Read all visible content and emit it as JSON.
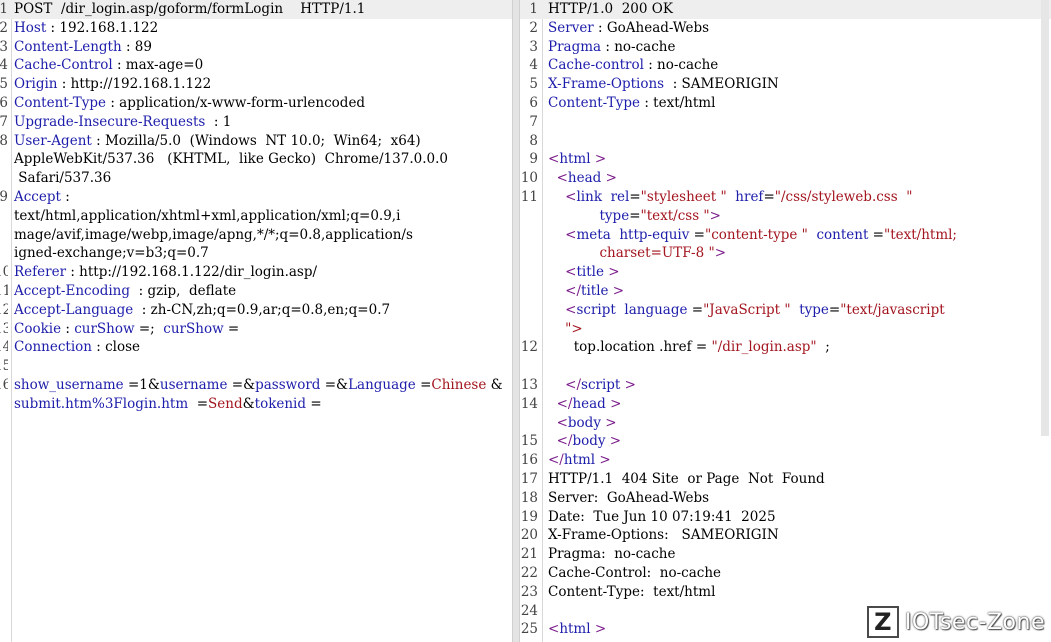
{
  "request": {
    "lines": [
      {
        "num": "1",
        "parts": [
          {
            "t": "POST  /dir_login.asp/goform/formLogin    HTTP/1.1",
            "c": "d"
          }
        ],
        "hl": true
      },
      {
        "num": "2",
        "parts": [
          {
            "t": "Host",
            "c": "k"
          },
          {
            "t": " : 192.168.1.122",
            "c": "d"
          }
        ]
      },
      {
        "num": "3",
        "parts": [
          {
            "t": "Content-Length",
            "c": "k"
          },
          {
            "t": " : 89",
            "c": "d"
          }
        ]
      },
      {
        "num": "4",
        "parts": [
          {
            "t": "Cache-Control",
            "c": "k"
          },
          {
            "t": " : max-age=0",
            "c": "d"
          }
        ]
      },
      {
        "num": "5",
        "parts": [
          {
            "t": "Origin",
            "c": "k"
          },
          {
            "t": " : http://192.168.1.122",
            "c": "d"
          }
        ]
      },
      {
        "num": "6",
        "parts": [
          {
            "t": "Content-Type",
            "c": "k"
          },
          {
            "t": " : application/x-www-form-urlencoded",
            "c": "d"
          }
        ]
      },
      {
        "num": "7",
        "parts": [
          {
            "t": "Upgrade-Insecure-Requests",
            "c": "k"
          },
          {
            "t": "  : 1",
            "c": "d"
          }
        ]
      },
      {
        "num": "8",
        "parts": [
          {
            "t": "User-Agent",
            "c": "k"
          },
          {
            "t": " : Mozilla/5.0  (Windows  NT 10.0;  Win64;  x64)",
            "c": "d"
          }
        ]
      },
      {
        "num": "",
        "parts": [
          {
            "t": "AppleWebKit/537.36   (KHTML,  like Gecko)  Chrome/137.0.0.0",
            "c": "d"
          }
        ]
      },
      {
        "num": "",
        "parts": [
          {
            "t": " Safari/537.36",
            "c": "d"
          }
        ]
      },
      {
        "num": "9",
        "parts": [
          {
            "t": "Accept",
            "c": "k"
          },
          {
            "t": " :",
            "c": "d"
          }
        ]
      },
      {
        "num": "",
        "parts": [
          {
            "t": "text/html,application/xhtml+xml,application/xml;q=0.9,i",
            "c": "d"
          }
        ]
      },
      {
        "num": "",
        "parts": [
          {
            "t": "mage/avif,image/webp,image/apng,*/*;q=0.8,application/s",
            "c": "d"
          }
        ]
      },
      {
        "num": "",
        "parts": [
          {
            "t": "igned-exchange;v=b3;q=0.7",
            "c": "d"
          }
        ]
      },
      {
        "num": "10",
        "parts": [
          {
            "t": "Referer",
            "c": "k"
          },
          {
            "t": " : http://192.168.1.122/dir_login.asp/",
            "c": "d"
          }
        ]
      },
      {
        "num": "11",
        "parts": [
          {
            "t": "Accept-Encoding",
            "c": "k"
          },
          {
            "t": "  : gzip,  deflate",
            "c": "d"
          }
        ]
      },
      {
        "num": "12",
        "parts": [
          {
            "t": "Accept-Language",
            "c": "k"
          },
          {
            "t": "  : zh-CN,zh;q=0.9,ar;q=0.8,en;q=0.7",
            "c": "d"
          }
        ]
      },
      {
        "num": "13",
        "parts": [
          {
            "t": "Cookie",
            "c": "k"
          },
          {
            "t": " : ",
            "c": "d"
          },
          {
            "t": "curShow",
            "c": "k"
          },
          {
            "t": " =;  ",
            "c": "d"
          },
          {
            "t": "curShow",
            "c": "k"
          },
          {
            "t": " =",
            "c": "d"
          }
        ]
      },
      {
        "num": "14",
        "parts": [
          {
            "t": "Connection",
            "c": "k"
          },
          {
            "t": " : close",
            "c": "d"
          }
        ]
      },
      {
        "num": "15",
        "parts": []
      },
      {
        "num": "16",
        "parts": [
          {
            "t": "show_username",
            "c": "k"
          },
          {
            "t": " =1&",
            "c": "d"
          },
          {
            "t": "username",
            "c": "k"
          },
          {
            "t": " =&",
            "c": "d"
          },
          {
            "t": "password",
            "c": "k"
          },
          {
            "t": " =&",
            "c": "d"
          },
          {
            "t": "Language",
            "c": "k"
          },
          {
            "t": " =",
            "c": "d"
          },
          {
            "t": "Chinese",
            "c": "s"
          },
          {
            "t": " &",
            "c": "d"
          }
        ]
      },
      {
        "num": "",
        "parts": [
          {
            "t": "submit.htm%3Flogin.htm",
            "c": "k"
          },
          {
            "t": "  =",
            "c": "d"
          },
          {
            "t": "Send",
            "c": "s"
          },
          {
            "t": "&",
            "c": "d"
          },
          {
            "t": "tokenid",
            "c": "k"
          },
          {
            "t": " =",
            "c": "d"
          }
        ]
      }
    ]
  },
  "response": {
    "lines": [
      {
        "num": "1",
        "parts": [
          {
            "t": "HTTP/1.0  200 OK",
            "c": "d"
          }
        ],
        "hl": true
      },
      {
        "num": "2",
        "parts": [
          {
            "t": "Server",
            "c": "k"
          },
          {
            "t": " : GoAhead-Webs",
            "c": "d"
          }
        ]
      },
      {
        "num": "3",
        "parts": [
          {
            "t": "Pragma",
            "c": "k"
          },
          {
            "t": " : no-cache",
            "c": "d"
          }
        ]
      },
      {
        "num": "4",
        "parts": [
          {
            "t": "Cache-control",
            "c": "k"
          },
          {
            "t": " : no-cache",
            "c": "d"
          }
        ]
      },
      {
        "num": "5",
        "parts": [
          {
            "t": "X-Frame-Options",
            "c": "k"
          },
          {
            "t": "  : SAMEORIGIN",
            "c": "d"
          }
        ]
      },
      {
        "num": "6",
        "parts": [
          {
            "t": "Content-Type",
            "c": "k"
          },
          {
            "t": " : text/html",
            "c": "d"
          }
        ]
      },
      {
        "num": "7",
        "parts": []
      },
      {
        "num": "8",
        "parts": []
      },
      {
        "num": "9",
        "parts": [
          {
            "t": "<",
            "c": "t"
          },
          {
            "t": "html",
            "c": "p"
          },
          {
            "t": " >",
            "c": "t"
          }
        ]
      },
      {
        "num": "10",
        "parts": [
          {
            "t": "  <",
            "c": "t"
          },
          {
            "t": "head",
            "c": "p"
          },
          {
            "t": " >",
            "c": "t"
          }
        ]
      },
      {
        "num": "11",
        "parts": [
          {
            "t": "    <",
            "c": "t"
          },
          {
            "t": "link",
            "c": "p"
          },
          {
            "t": "  ",
            "c": "d"
          },
          {
            "t": "rel",
            "c": "p"
          },
          {
            "t": "=",
            "c": "d"
          },
          {
            "t": "\"stylesheet \"",
            "c": "v"
          },
          {
            "t": "  ",
            "c": "d"
          },
          {
            "t": "href",
            "c": "p"
          },
          {
            "t": "=",
            "c": "d"
          },
          {
            "t": "\"/css/styleweb.css  \"",
            "c": "v"
          }
        ]
      },
      {
        "num": "",
        "parts": [
          {
            "t": "            ",
            "c": "d"
          },
          {
            "t": "type",
            "c": "p"
          },
          {
            "t": "=",
            "c": "d"
          },
          {
            "t": "\"text/css \"",
            "c": "v"
          },
          {
            "t": ">",
            "c": "t"
          }
        ]
      },
      {
        "num": "",
        "parts": [
          {
            "t": "    <",
            "c": "t"
          },
          {
            "t": "meta",
            "c": "p"
          },
          {
            "t": "  ",
            "c": "d"
          },
          {
            "t": "http-equiv",
            "c": "p"
          },
          {
            "t": " =",
            "c": "d"
          },
          {
            "t": "\"content-type \"",
            "c": "v"
          },
          {
            "t": "  ",
            "c": "d"
          },
          {
            "t": "content",
            "c": "p"
          },
          {
            "t": " =",
            "c": "d"
          },
          {
            "t": "\"text/html;",
            "c": "v"
          }
        ]
      },
      {
        "num": "",
        "parts": [
          {
            "t": "            ",
            "c": "d"
          },
          {
            "t": "charset=UTF-8 \"",
            "c": "v"
          },
          {
            "t": ">",
            "c": "t"
          }
        ]
      },
      {
        "num": "",
        "parts": [
          {
            "t": "    <",
            "c": "t"
          },
          {
            "t": "title",
            "c": "p"
          },
          {
            "t": " >",
            "c": "t"
          }
        ]
      },
      {
        "num": "",
        "parts": [
          {
            "t": "    </",
            "c": "t"
          },
          {
            "t": "title",
            "c": "p"
          },
          {
            "t": " >",
            "c": "t"
          }
        ]
      },
      {
        "num": "",
        "parts": [
          {
            "t": "    <",
            "c": "t"
          },
          {
            "t": "script",
            "c": "p"
          },
          {
            "t": "  ",
            "c": "d"
          },
          {
            "t": "language",
            "c": "p"
          },
          {
            "t": " =",
            "c": "d"
          },
          {
            "t": "\"JavaScript \"",
            "c": "v"
          },
          {
            "t": "  ",
            "c": "d"
          },
          {
            "t": "type",
            "c": "p"
          },
          {
            "t": "=",
            "c": "d"
          },
          {
            "t": "\"text/javascript",
            "c": "v"
          }
        ]
      },
      {
        "num": "",
        "parts": [
          {
            "t": "    \">",
            "c": "v"
          }
        ]
      },
      {
        "num": "12",
        "parts": [
          {
            "t": "      top.location",
            "c": "d"
          },
          {
            "t": " .",
            "c": "d"
          },
          {
            "t": "href",
            "c": "d"
          },
          {
            "t": " = ",
            "c": "d"
          },
          {
            "t": "\"/dir_login.asp\"",
            "c": "v"
          },
          {
            "t": "  ;",
            "c": "d"
          }
        ]
      },
      {
        "num": "",
        "parts": []
      },
      {
        "num": "13",
        "parts": [
          {
            "t": "    </",
            "c": "t"
          },
          {
            "t": "script",
            "c": "p"
          },
          {
            "t": " >",
            "c": "t"
          }
        ]
      },
      {
        "num": "14",
        "parts": [
          {
            "t": "  </",
            "c": "t"
          },
          {
            "t": "head",
            "c": "p"
          },
          {
            "t": " >",
            "c": "t"
          }
        ]
      },
      {
        "num": "",
        "parts": [
          {
            "t": "  <",
            "c": "t"
          },
          {
            "t": "body",
            "c": "p"
          },
          {
            "t": " >",
            "c": "t"
          }
        ]
      },
      {
        "num": "15",
        "parts": [
          {
            "t": "  </",
            "c": "t"
          },
          {
            "t": "body",
            "c": "p"
          },
          {
            "t": " >",
            "c": "t"
          }
        ]
      },
      {
        "num": "16",
        "parts": [
          {
            "t": "</",
            "c": "t"
          },
          {
            "t": "html",
            "c": "p"
          },
          {
            "t": " >",
            "c": "t"
          }
        ]
      },
      {
        "num": "17",
        "parts": [
          {
            "t": "HTTP/1.1  404 Site  or Page  Not  Found",
            "c": "d"
          }
        ]
      },
      {
        "num": "18",
        "parts": [
          {
            "t": "Server:  GoAhead-Webs",
            "c": "d"
          }
        ]
      },
      {
        "num": "19",
        "parts": [
          {
            "t": "Date:  Tue Jun 10 07:19:41  2025",
            "c": "d"
          }
        ]
      },
      {
        "num": "20",
        "parts": [
          {
            "t": "X-Frame-Options:   SAMEORIGIN",
            "c": "d"
          }
        ]
      },
      {
        "num": "21",
        "parts": [
          {
            "t": "Pragma:  no-cache",
            "c": "d"
          }
        ]
      },
      {
        "num": "22",
        "parts": [
          {
            "t": "Cache-Control:  no-cache",
            "c": "d"
          }
        ]
      },
      {
        "num": "23",
        "parts": [
          {
            "t": "Content-Type:  text/html",
            "c": "d"
          }
        ]
      },
      {
        "num": "24",
        "parts": []
      },
      {
        "num": "25",
        "parts": [
          {
            "t": "<",
            "c": "t"
          },
          {
            "t": "html",
            "c": "p"
          },
          {
            "t": " >",
            "c": "t"
          }
        ]
      }
    ]
  },
  "watermark": {
    "mark": "Z",
    "text": "IOTsec-Zone"
  },
  "colors": {
    "header_key": "#1d1dab",
    "tag": "#7a1a8a",
    "string": "#a3151f",
    "highlight": "#eeeeee"
  }
}
